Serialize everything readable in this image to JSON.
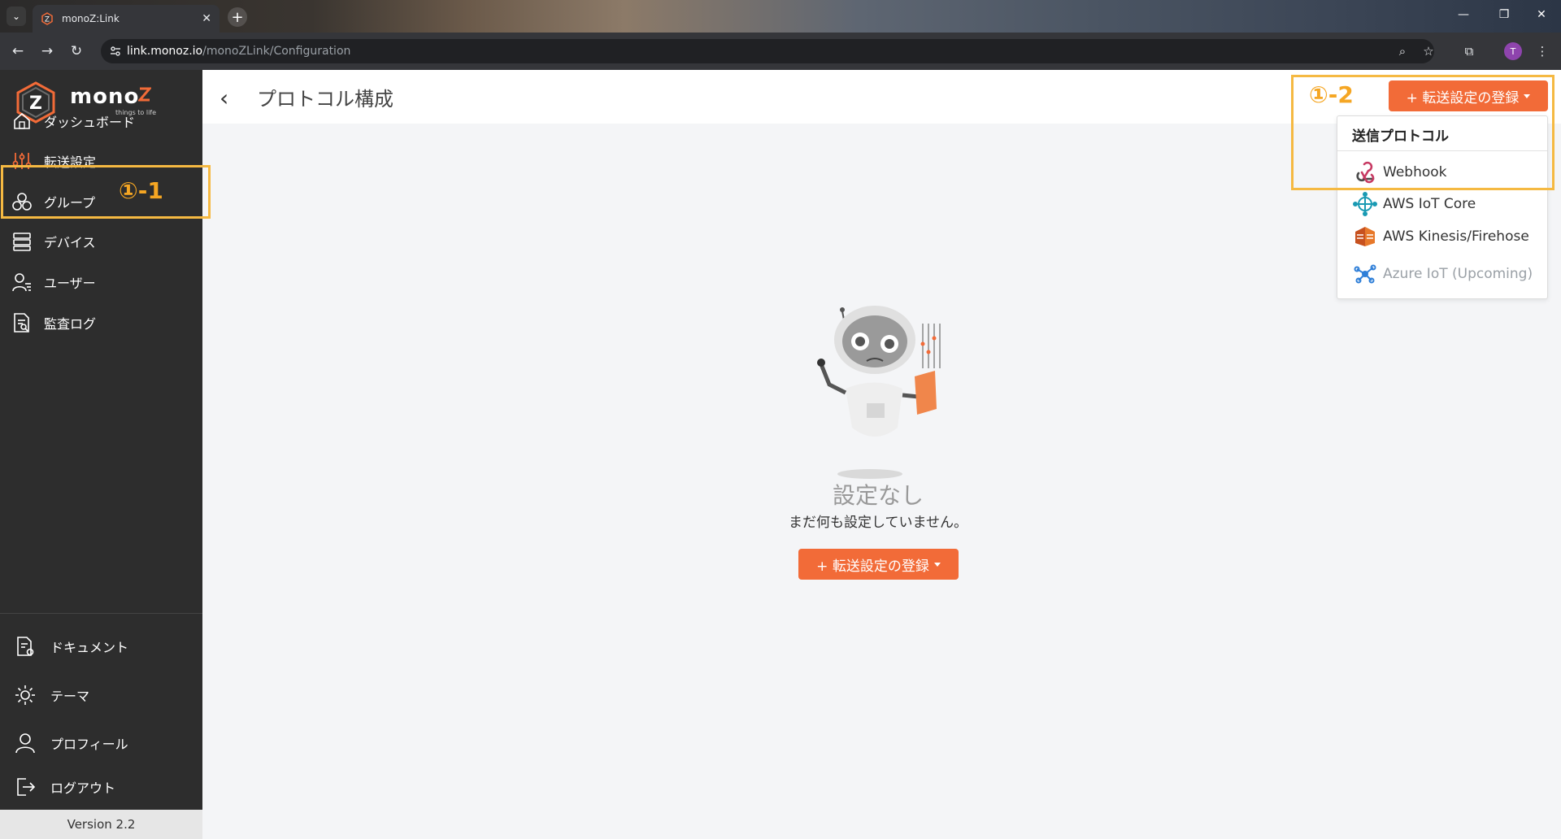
{
  "browser": {
    "tab_title": "monoZ:Link",
    "url_host": "link.monoz.io",
    "url_path": "/monoZLink/Configuration",
    "profile_initial": "T",
    "accent": "#8e44ad"
  },
  "sidebar": {
    "logo_text": "mono",
    "logo_tagline": "things to life",
    "items": [
      {
        "label": "ダッシュボード",
        "icon": "dashboard-icon"
      },
      {
        "label": "転送設定",
        "icon": "sliders-icon"
      },
      {
        "label": "グループ",
        "icon": "group-icon"
      },
      {
        "label": "デバイス",
        "icon": "device-icon"
      },
      {
        "label": "ユーザー",
        "icon": "users-icon"
      },
      {
        "label": "監査ログ",
        "icon": "audit-log-icon"
      }
    ],
    "bottom_items": [
      {
        "label": "ドキュメント",
        "icon": "document-icon"
      },
      {
        "label": "テーマ",
        "icon": "sun-icon"
      },
      {
        "label": "プロフィール",
        "icon": "profile-icon"
      },
      {
        "label": "ログアウト",
        "icon": "logout-icon"
      }
    ],
    "version": "Version 2.2"
  },
  "annotations": {
    "label_1": "①-1",
    "label_2": "①-2",
    "color": "#f5b942"
  },
  "header": {
    "title": "プロトコル構成",
    "register_button": "+ 転送設定の登録"
  },
  "dropdown": {
    "header": "送信プロトコル",
    "items": [
      {
        "label": "Webhook",
        "icon": "webhook-icon",
        "enabled": true
      },
      {
        "label": "AWS IoT Core",
        "icon": "aws-iot-core-icon",
        "enabled": true
      },
      {
        "label": "AWS Kinesis/Firehose",
        "icon": "aws-kinesis-icon",
        "enabled": true
      },
      {
        "label": "Azure IoT (Upcoming)",
        "icon": "azure-iot-icon",
        "enabled": false
      }
    ]
  },
  "empty_state": {
    "title": "設定なし",
    "message": "まだ何も設定していません。",
    "button": "+ 転送設定の登録"
  },
  "colors": {
    "primary": "#f26b38",
    "sidebar_bg": "#2d2d2d"
  }
}
